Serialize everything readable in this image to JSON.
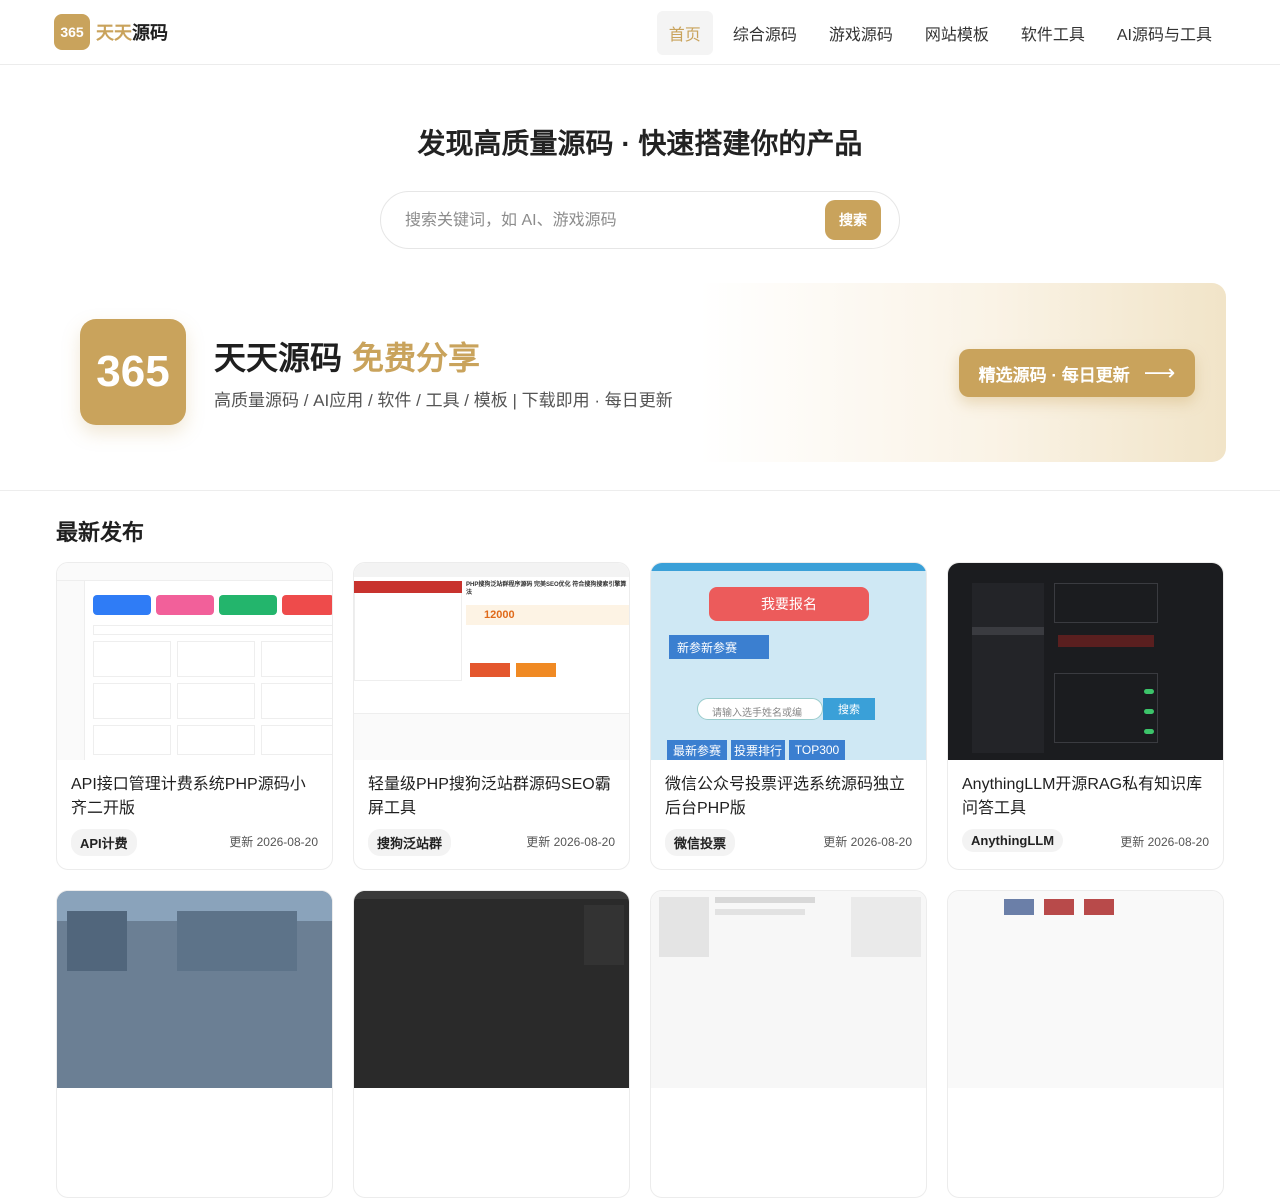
{
  "header": {
    "logo_badge": "365",
    "logo_text_gold": "天天",
    "logo_text_dark": "源码",
    "nav": [
      "首页",
      "综合源码",
      "游戏源码",
      "网站模板",
      "软件工具",
      "AI源码与工具"
    ]
  },
  "hero": {
    "title": "发现高质量源码 · 快速搭建你的产品",
    "search_placeholder": "搜索关键词，如 AI、游戏源码",
    "search_button": "搜索"
  },
  "banner": {
    "logo": "365",
    "title_dark": "天天源码",
    "title_gold": "免费分享",
    "subtitle": "高质量源码 / AI应用 / 软件 / 工具 / 模板 | 下载即用 · 每日更新",
    "cta": "精选源码 · 每日更新",
    "cta_icon": "arrow-right-icon"
  },
  "section": {
    "title": "最新发布"
  },
  "cards": [
    {
      "title": "API接口管理计费系统PHP源码小齐二开版",
      "tag": "API计费",
      "date": "更新 2026-08-20"
    },
    {
      "title": "轻量级PHP搜狗泛站群源码SEO霸屏工具",
      "tag": "搜狗泛站群",
      "date": "更新 2026-08-20"
    },
    {
      "title": "微信公众号投票评选系统源码独立后台PHP版",
      "tag": "微信投票",
      "date": "更新 2026-08-20"
    },
    {
      "title": "AnythingLLM开源RAG私有知识库问答工具",
      "tag": "AnythingLLM",
      "date": "更新 2026-08-20"
    }
  ],
  "thumb_text": {
    "t2_heading": "PHP搜狗泛站群程序源码 完美SEO优化 符合搜狗搜索引擎算法",
    "t2_price": "12000",
    "t3_register": "我要报名",
    "t3_new": "新参新参赛",
    "t3_input": "请输入选手姓名或编",
    "t3_search": "搜索",
    "t3_tabs": [
      "最新参赛",
      "投票排行",
      "TOP300"
    ]
  },
  "colors": {
    "accent": "#c9a35c"
  }
}
